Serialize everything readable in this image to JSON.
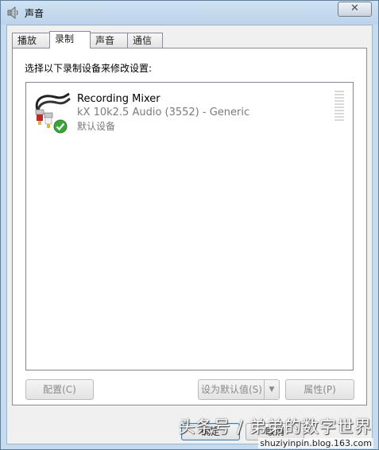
{
  "window": {
    "title": "声音",
    "close_label": "✕"
  },
  "tabs": [
    {
      "label": "播放"
    },
    {
      "label": "录制",
      "active": true
    },
    {
      "label": "声音"
    },
    {
      "label": "通信"
    }
  ],
  "panel": {
    "instruction": "选择以下录制设备来修改设置:"
  },
  "devices": [
    {
      "name": "Recording Mixer",
      "description": "kX 10k2.5 Audio (3552) - Generic",
      "status": "默认设备",
      "icon": "audio-cable-icon",
      "default_badge_icon": "green-check-icon"
    }
  ],
  "buttons": {
    "configure": "配置(C)",
    "set_default": "设为默认值(S)",
    "properties": "属性(P)",
    "ok": "确定",
    "cancel": "取消"
  },
  "watermark": {
    "text": "头条号 / 弟弟的数字世界",
    "url": "shuziyinpin.blog.163.com"
  }
}
